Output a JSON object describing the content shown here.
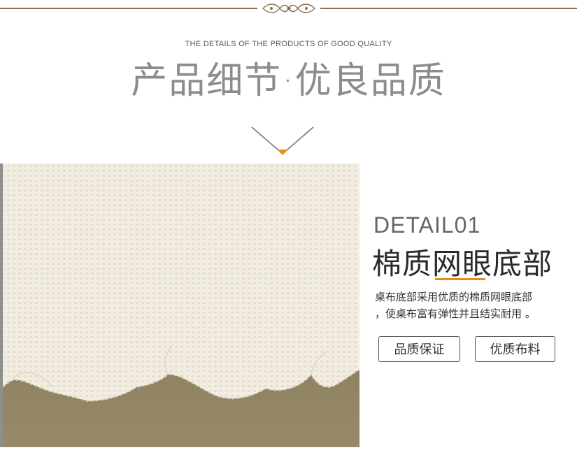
{
  "header": {
    "subtitle_en": "THE DETAILS OF THE PRODUCTS OF GOOD QUALITY",
    "title_cn": "产品细节·优良品质"
  },
  "detail": {
    "number": "DETAIL01",
    "title": "棉质网眼底部",
    "description_line1": "桌布底部采用优质的棉质网眼底部",
    "description_line2": "，使桌布富有弹性并且结实耐用 。",
    "tags": [
      "品质保证",
      "优质布料"
    ]
  },
  "colors": {
    "accent": "#e09020",
    "divider": "#8a7350",
    "fabric": "#f3eee2",
    "background_table": "#8a7e5e"
  },
  "icons": {
    "ornament": "ornament-divider-icon",
    "chevron": "chevron-down-icon"
  }
}
